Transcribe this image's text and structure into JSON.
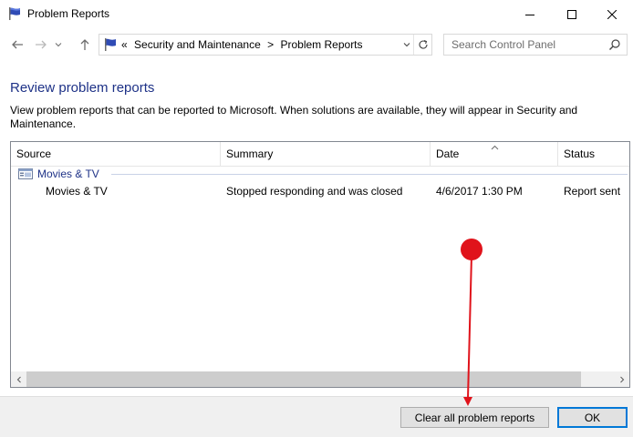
{
  "window": {
    "title": "Problem Reports"
  },
  "nav": {
    "address": {
      "overflow": "«",
      "crumbs": [
        "Security and Maintenance",
        "Problem Reports"
      ],
      "separator": ">"
    },
    "search": {
      "placeholder": "Search Control Panel",
      "value": ""
    }
  },
  "content": {
    "heading": "Review problem reports",
    "description": "View problem reports that can be reported to Microsoft. When solutions are available, they will appear in Security and Maintenance."
  },
  "list": {
    "columns": [
      "Source",
      "Summary",
      "Date",
      "Status"
    ],
    "sorted_column": "Date",
    "groups": [
      {
        "name": "Movies & TV",
        "rows": [
          {
            "source": "Movies & TV",
            "summary": "Stopped responding and was closed",
            "date": "4/6/2017 1:30 PM",
            "status": "Report sent"
          }
        ]
      }
    ]
  },
  "footer": {
    "clear_label": "Clear all problem reports",
    "ok_label": "OK"
  },
  "icons": {
    "title": "flag-icon",
    "back": "arrow-left-icon",
    "forward": "arrow-right-icon",
    "recent": "chevron-down-icon",
    "up": "arrow-up-icon",
    "refresh": "refresh-icon",
    "search": "search-icon",
    "group": "app-window-icon"
  },
  "colors": {
    "heading": "#1e3287",
    "accent_button": "#0078d7",
    "annotation": "#e0131b"
  }
}
